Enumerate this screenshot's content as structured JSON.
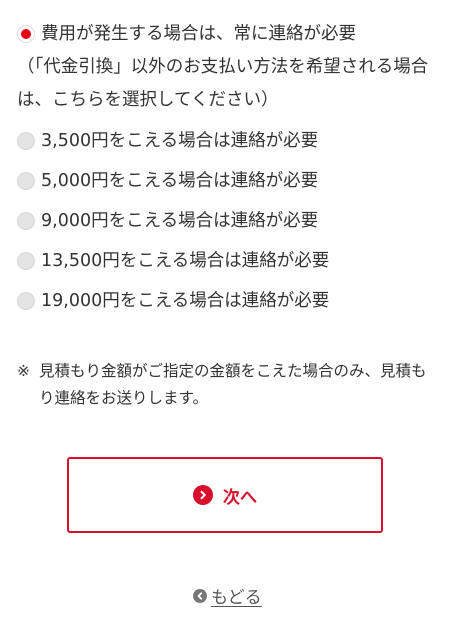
{
  "options": [
    {
      "checked": true,
      "line1": "費用が発生する場合は、常に連絡が必要",
      "line2": "（「代金引換」以外のお支払い方法を希望される場合は、こちらを選択してください）"
    },
    {
      "checked": false,
      "label": "3,500円をこえる場合は連絡が必要"
    },
    {
      "checked": false,
      "label": "5,000円をこえる場合は連絡が必要"
    },
    {
      "checked": false,
      "label": "9,000円をこえる場合は連絡が必要"
    },
    {
      "checked": false,
      "label": "13,500円をこえる場合は連絡が必要"
    },
    {
      "checked": false,
      "label": "19,000円をこえる場合は連絡が必要"
    }
  ],
  "note": {
    "mark": "※",
    "text": "見積もり金額がご指定の金額をこえた場合のみ、見積もり連絡をお送りします。"
  },
  "next_button": {
    "label": "次へ",
    "icon": "chevron-right-circle-icon"
  },
  "back_link": {
    "label": "もどる",
    "icon": "chevron-left-circle-icon"
  },
  "colors": {
    "accent": "#d8102c",
    "text": "#333333"
  }
}
